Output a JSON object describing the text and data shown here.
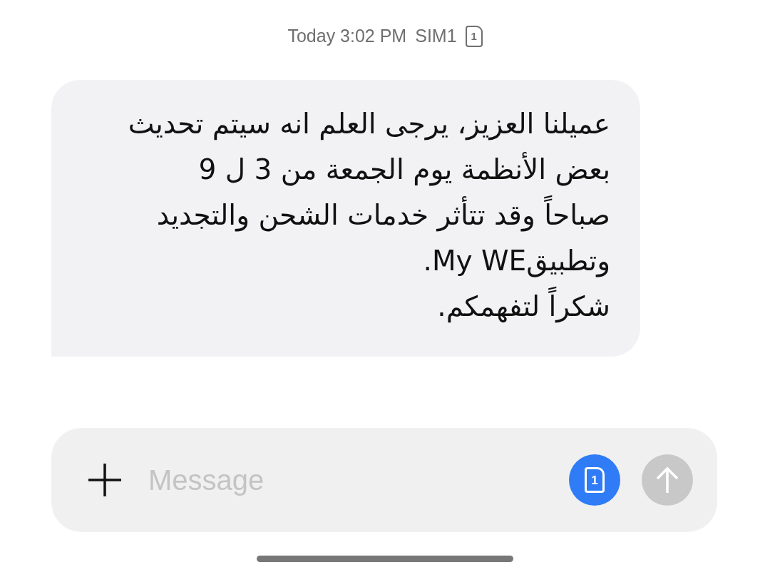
{
  "header": {
    "time": "Today 3:02 PM",
    "sim": "SIM1",
    "sim_icon_digit": "1"
  },
  "message": {
    "text": "عميلنا العزيز، يرجى العلم انه سيتم تحديث\nبعض الأنظمة يوم الجمعة من 3 ل 9\nصباحاً وقد تتأثر خدمات الشحن والتجديد\nوتطبيقMy WE.\nشكراً لتفهمكم."
  },
  "composer": {
    "placeholder": "Message",
    "sim_digit": "1",
    "send_enabled": false
  }
}
